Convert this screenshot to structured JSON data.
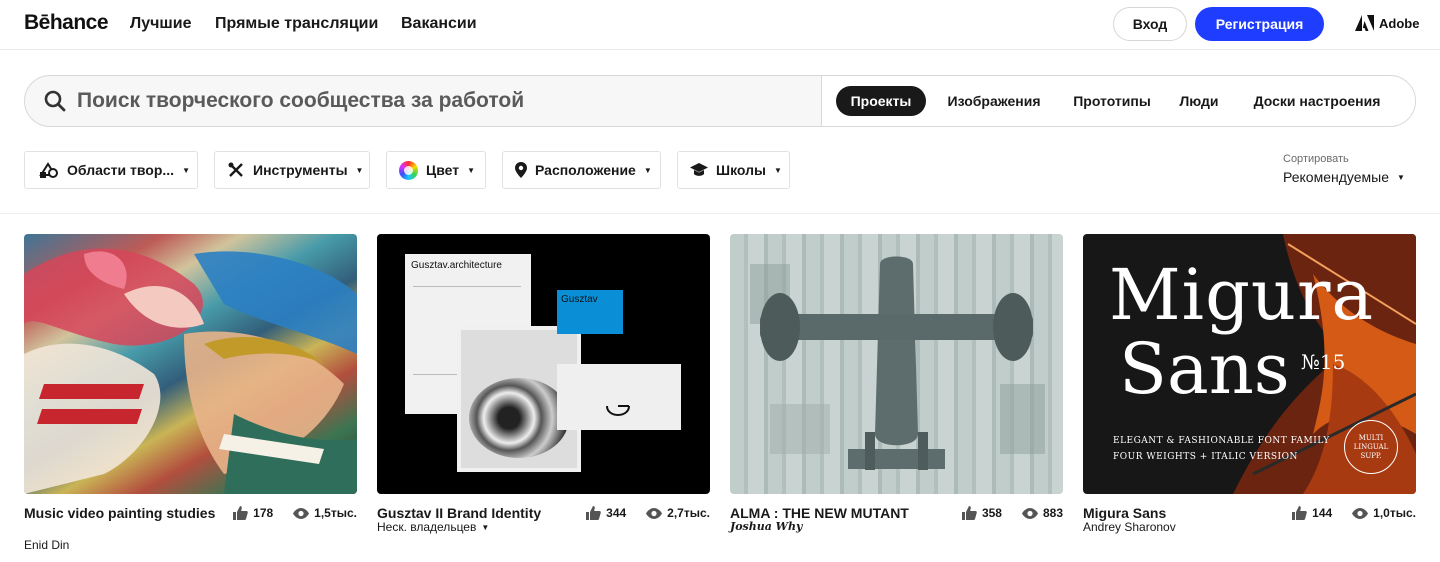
{
  "nav": {
    "logo": "Bēhance",
    "links": [
      "Лучшие",
      "Прямые трансляции",
      "Вакансии"
    ],
    "login": "Вход",
    "signup": "Регистрация",
    "adobe": "Adobe"
  },
  "search": {
    "placeholder": "Поиск творческого сообщества за работой",
    "tabs": [
      "Проекты",
      "Изображения",
      "Прототипы",
      "Люди",
      "Доски настроения"
    ],
    "active_tab": "Проекты"
  },
  "filters": [
    "Области твор...",
    "Инструменты",
    "Цвет",
    "Расположение",
    "Школы"
  ],
  "sort": {
    "label": "Сортировать",
    "value": "Рекомендуемые"
  },
  "cards": [
    {
      "title": "Music video painting studies",
      "owner": "Enid Din",
      "likes": "178",
      "views": "1,5тыс."
    },
    {
      "title": "Gusztav II Brand Identity",
      "owner": "Неск. владельцев",
      "likes": "344",
      "views": "2,7тыс."
    },
    {
      "title": "ALMA : THE NEW MUTANT",
      "owner": "Joshua Why",
      "likes": "358",
      "views": "883"
    },
    {
      "title": "Migura Sans",
      "owner": "Andrey Sharonov",
      "likes": "144",
      "views": "1,0тыс."
    }
  ],
  "artwork": {
    "gusztav_header": "Gusztav.architecture",
    "gusztav_card": "Gusztav",
    "migura_line1": "Migura",
    "migura_line2": "Sans",
    "migura_no": "№15",
    "migura_tag1": "ELEGANT & FASHIONABLE FONT FAMILY",
    "migura_tag2": "FOUR WEIGHTS + ITALIC VERSION",
    "migura_badge": "MULTI LINGUAL SUPP."
  },
  "colors": {
    "accent": "#1f3dff",
    "active_tab": "#191919"
  }
}
